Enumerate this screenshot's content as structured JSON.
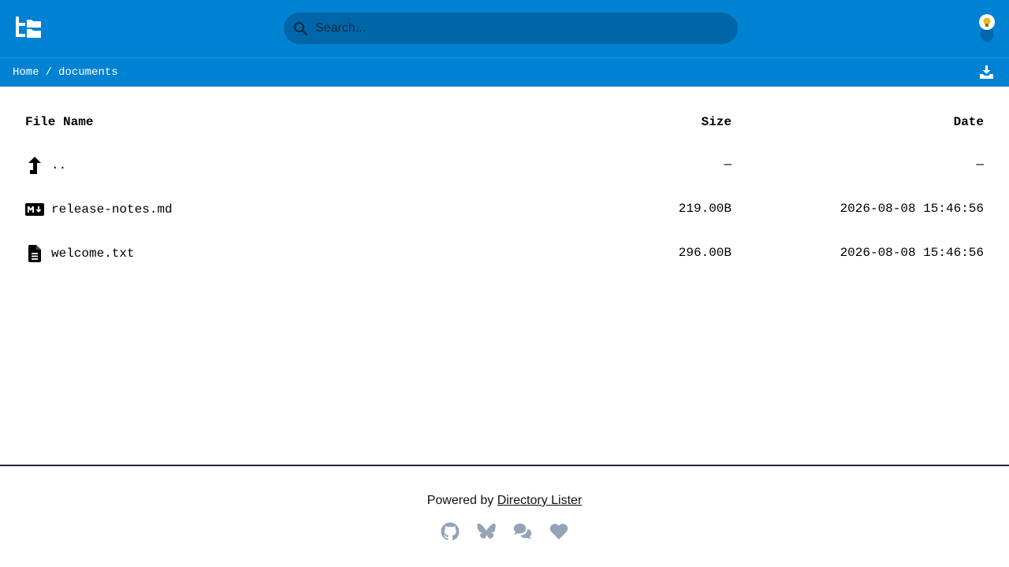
{
  "header": {
    "logo_icon": "directory-tree-icon",
    "search": {
      "placeholder": "Search...",
      "value": ""
    },
    "theme_toggle_icon": "lightbulb-icon",
    "bar_color": "#0082d2"
  },
  "breadcrumb": {
    "items": [
      "Home",
      "documents"
    ],
    "separator": "/",
    "download_icon": "download-icon"
  },
  "listing": {
    "columns": {
      "name": "File Name",
      "size": "Size",
      "date": "Date"
    },
    "rows": [
      {
        "icon": "level-up-icon",
        "name": "..",
        "size": "—",
        "date": "—"
      },
      {
        "icon": "markdown-icon",
        "name": "release-notes.md",
        "size": "219.00B",
        "date": "2026-08-08 15:46:56"
      },
      {
        "icon": "file-text-icon",
        "name": "welcome.txt",
        "size": "296.00B",
        "date": "2026-08-08 15:46:56"
      }
    ]
  },
  "footer": {
    "powered_prefix": "Powered by",
    "powered_link": "Directory Lister",
    "social_icons": [
      "github-icon",
      "bluesky-icon",
      "chat-icon",
      "heart-icon"
    ],
    "icon_color": "#94a3b8"
  }
}
